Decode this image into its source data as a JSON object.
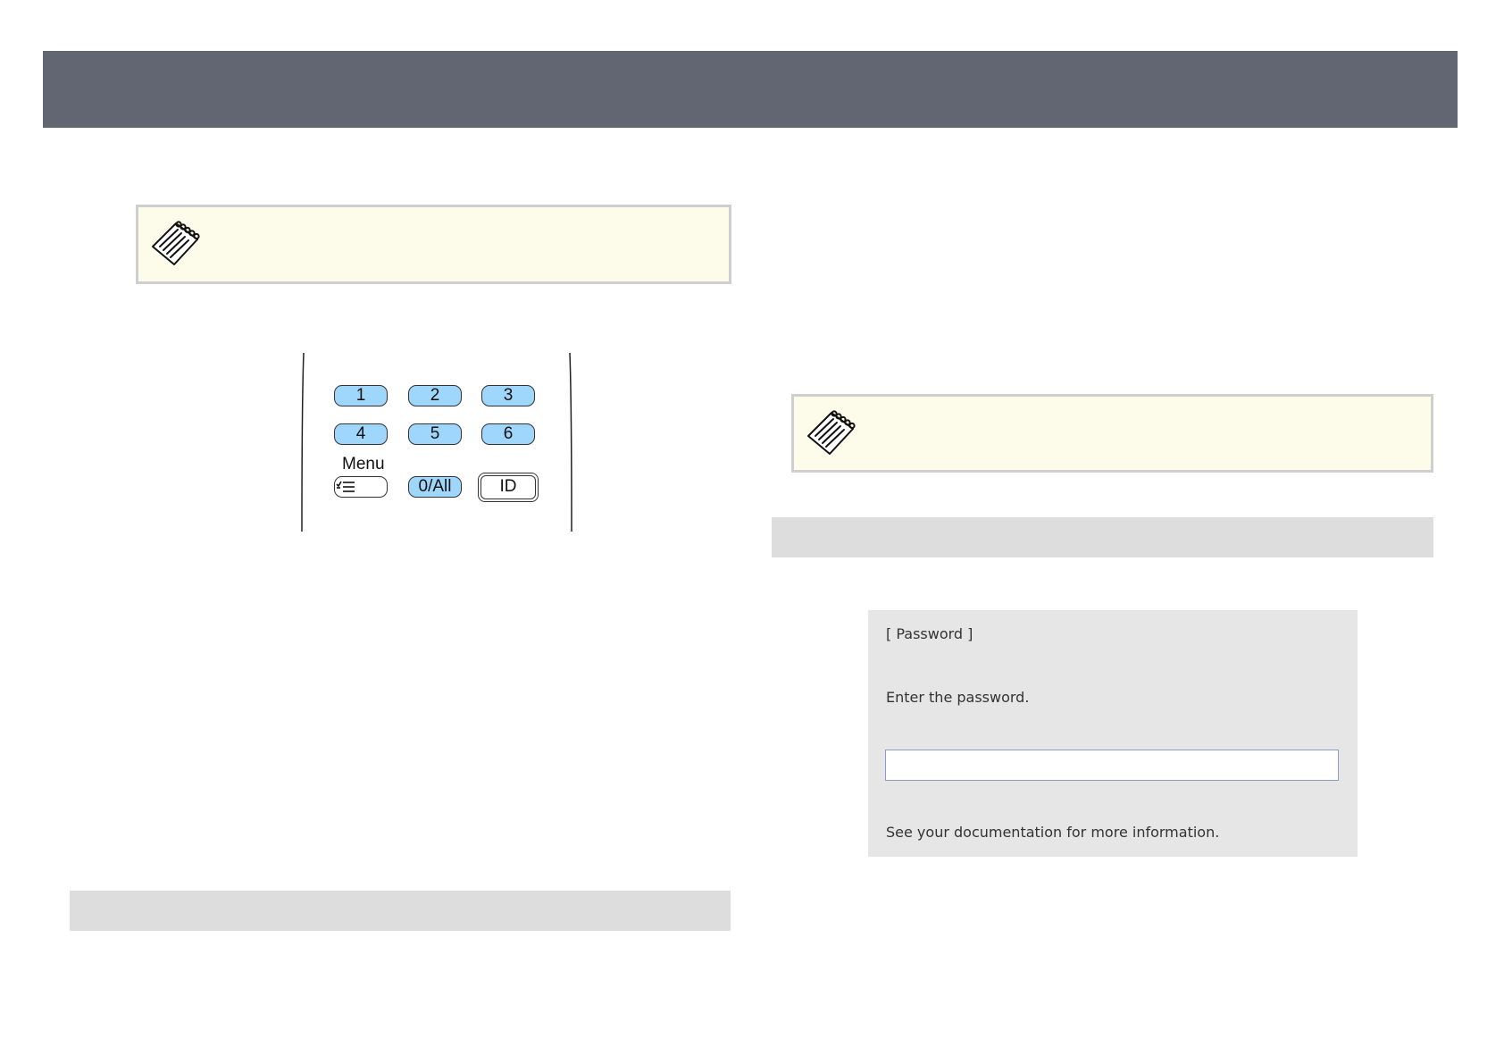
{
  "header": {
    "color": "#626673"
  },
  "notes": [
    {
      "icon": "note-icon"
    },
    {
      "icon": "note-icon"
    }
  ],
  "remote": {
    "buttons": [
      {
        "label": "1",
        "color": "#9fd6fb"
      },
      {
        "label": "2",
        "color": "#9fd6fb"
      },
      {
        "label": "3",
        "color": "#9fd6fb"
      },
      {
        "label": "4",
        "color": "#9fd6fb"
      },
      {
        "label": "5",
        "color": "#9fd6fb"
      },
      {
        "label": "6",
        "color": "#9fd6fb"
      },
      {
        "label": "0/All",
        "color": "#9fd6fb"
      },
      {
        "label": "ID",
        "color": "#ffffff"
      }
    ],
    "menu_label": "Menu",
    "menu_icon": "checklist-icon"
  },
  "dialog": {
    "title": "[ Password ]",
    "prompt": "Enter the password.",
    "input_value": "",
    "footer": "See your documentation for more information."
  }
}
